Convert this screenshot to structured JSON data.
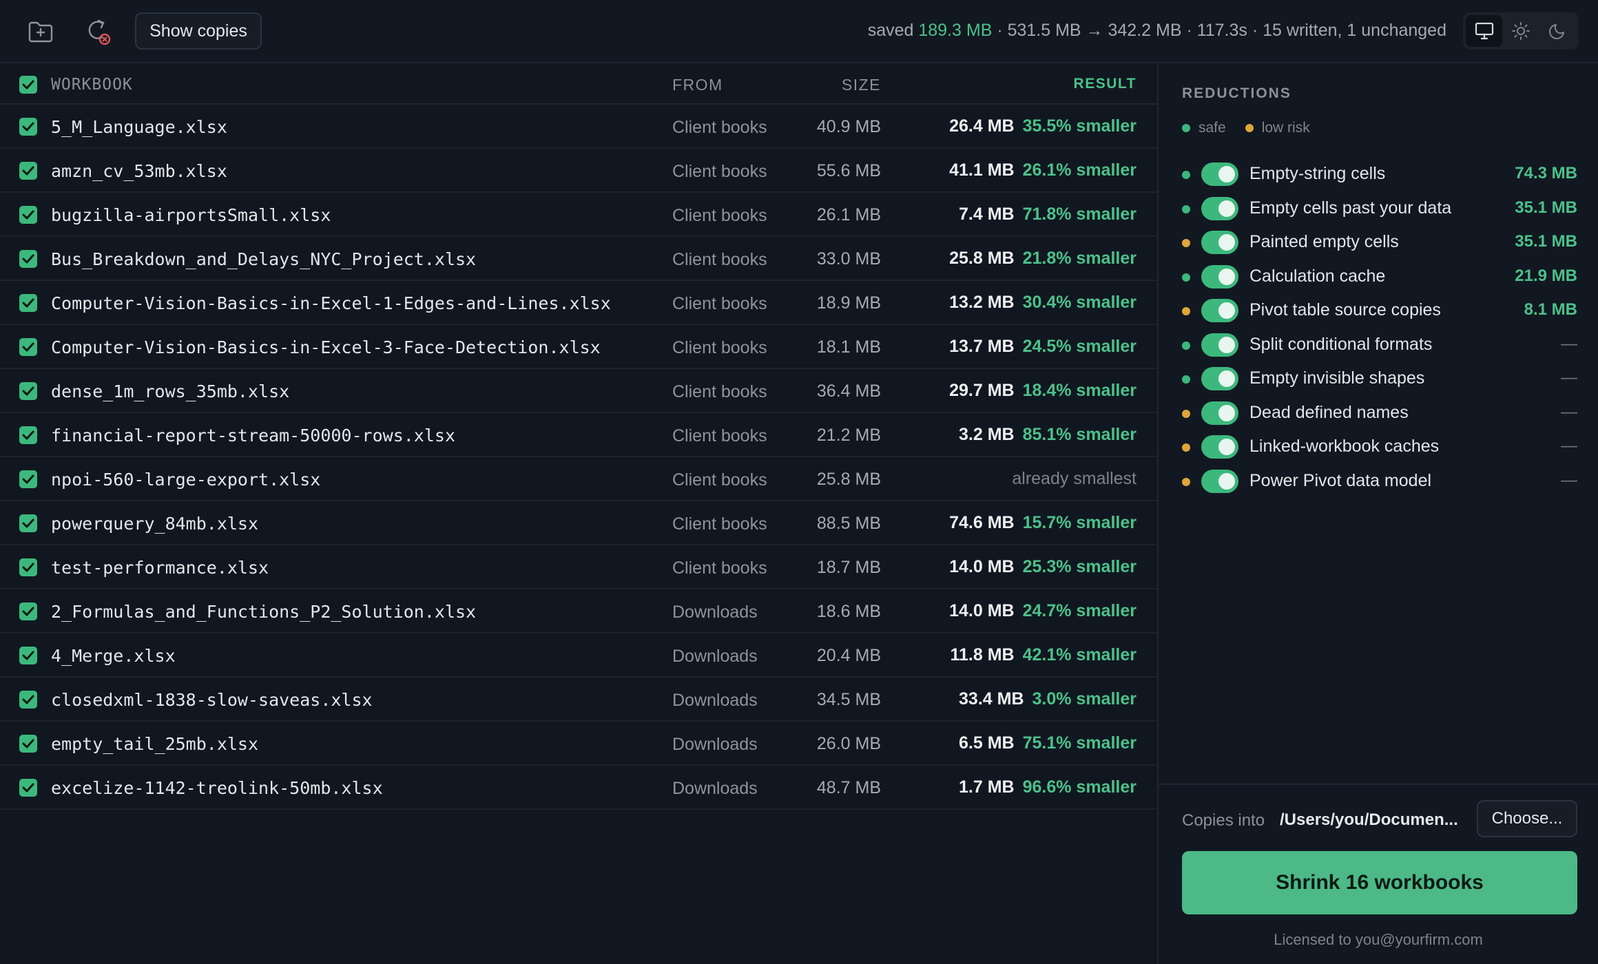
{
  "toolbar": {
    "add_folder_icon": "folder-plus-icon",
    "reset_icon": "refresh-cancel-icon",
    "show_copies_label": "Show copies"
  },
  "summary": {
    "saved_prefix": "saved ",
    "saved_value": "189.3 MB",
    "rest": " · 531.5 MB → 342.2 MB · 117.3s · 15 written, 1 unchanged"
  },
  "theme": {
    "options": [
      "monitor-icon",
      "sun-icon",
      "moon-icon"
    ],
    "active": "monitor-icon"
  },
  "table": {
    "headers": {
      "name": "WORKBOOK",
      "from": "FROM",
      "size": "SIZE",
      "result": "RESULT"
    },
    "rows": [
      {
        "name": "5_M_Language.xlsx",
        "from": "Client books",
        "size": "40.9 MB",
        "new_size": "26.4 MB",
        "pct": "35.5% smaller"
      },
      {
        "name": "amzn_cv_53mb.xlsx",
        "from": "Client books",
        "size": "55.6 MB",
        "new_size": "41.1 MB",
        "pct": "26.1% smaller"
      },
      {
        "name": "bugzilla-airportsSmall.xlsx",
        "from": "Client books",
        "size": "26.1 MB",
        "new_size": "7.4 MB",
        "pct": "71.8% smaller"
      },
      {
        "name": "Bus_Breakdown_and_Delays_NYC_Project.xlsx",
        "from": "Client books",
        "size": "33.0 MB",
        "new_size": "25.8 MB",
        "pct": "21.8% smaller"
      },
      {
        "name": "Computer-Vision-Basics-in-Excel-1-Edges-and-Lines.xlsx",
        "from": "Client books",
        "size": "18.9 MB",
        "new_size": "13.2 MB",
        "pct": "30.4% smaller"
      },
      {
        "name": "Computer-Vision-Basics-in-Excel-3-Face-Detection.xlsx",
        "from": "Client books",
        "size": "18.1 MB",
        "new_size": "13.7 MB",
        "pct": "24.5% smaller"
      },
      {
        "name": "dense_1m_rows_35mb.xlsx",
        "from": "Client books",
        "size": "36.4 MB",
        "new_size": "29.7 MB",
        "pct": "18.4% smaller"
      },
      {
        "name": "financial-report-stream-50000-rows.xlsx",
        "from": "Client books",
        "size": "21.2 MB",
        "new_size": "3.2 MB",
        "pct": "85.1% smaller"
      },
      {
        "name": "npoi-560-large-export.xlsx",
        "from": "Client books",
        "size": "25.8 MB",
        "new_size": "",
        "pct": "",
        "note": "already smallest"
      },
      {
        "name": "powerquery_84mb.xlsx",
        "from": "Client books",
        "size": "88.5 MB",
        "new_size": "74.6 MB",
        "pct": "15.7% smaller"
      },
      {
        "name": "test-performance.xlsx",
        "from": "Client books",
        "size": "18.7 MB",
        "new_size": "14.0 MB",
        "pct": "25.3% smaller"
      },
      {
        "name": "2_Formulas_and_Functions_P2_Solution.xlsx",
        "from": "Downloads",
        "size": "18.6 MB",
        "new_size": "14.0 MB",
        "pct": "24.7% smaller"
      },
      {
        "name": "4_Merge.xlsx",
        "from": "Downloads",
        "size": "20.4 MB",
        "new_size": "11.8 MB",
        "pct": "42.1% smaller"
      },
      {
        "name": "closedxml-1838-slow-saveas.xlsx",
        "from": "Downloads",
        "size": "34.5 MB",
        "new_size": "33.4 MB",
        "pct": "3.0% smaller"
      },
      {
        "name": "empty_tail_25mb.xlsx",
        "from": "Downloads",
        "size": "26.0 MB",
        "new_size": "6.5 MB",
        "pct": "75.1% smaller"
      },
      {
        "name": "excelize-1142-treolink-50mb.xlsx",
        "from": "Downloads",
        "size": "48.7 MB",
        "new_size": "1.7 MB",
        "pct": "96.6% smaller"
      }
    ]
  },
  "sidebar": {
    "title": "REDUCTIONS",
    "legend": {
      "safe": "safe",
      "risk": "low risk"
    },
    "reductions": [
      {
        "label": "Empty-string cells",
        "risk": "safe",
        "value": "74.3 MB",
        "enabled": true
      },
      {
        "label": "Empty cells past your data",
        "risk": "safe",
        "value": "35.1 MB",
        "enabled": true
      },
      {
        "label": "Painted empty cells",
        "risk": "low",
        "value": "35.1 MB",
        "enabled": true
      },
      {
        "label": "Calculation cache",
        "risk": "safe",
        "value": "21.9 MB",
        "enabled": true
      },
      {
        "label": "Pivot table source copies",
        "risk": "low",
        "value": "8.1 MB",
        "enabled": true
      },
      {
        "label": "Split conditional formats",
        "risk": "safe",
        "value": "—",
        "enabled": true
      },
      {
        "label": "Empty invisible shapes",
        "risk": "safe",
        "value": "—",
        "enabled": true
      },
      {
        "label": "Dead defined names",
        "risk": "low",
        "value": "—",
        "enabled": true
      },
      {
        "label": "Linked-workbook caches",
        "risk": "low",
        "value": "—",
        "enabled": true
      },
      {
        "label": "Power Pivot data model",
        "risk": "low",
        "value": "—",
        "enabled": true
      }
    ],
    "copies_label": "Copies into",
    "copies_path": "/Users/you/Documen...",
    "choose_label": "Choose...",
    "shrink_label": "Shrink 16 workbooks",
    "license": "Licensed to you@yourfirm.com"
  },
  "colors": {
    "accent": "#4cc18a",
    "risk": "#e0a53a",
    "background": "#111720"
  }
}
